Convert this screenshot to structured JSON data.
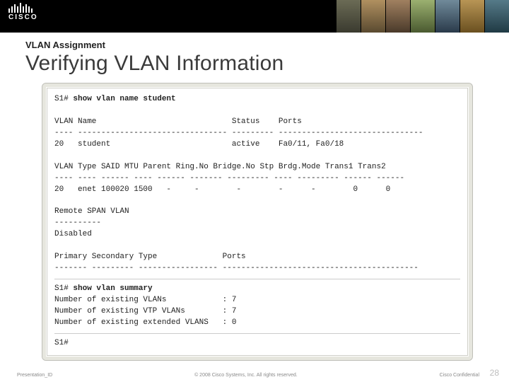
{
  "header": {
    "brand": "CISCO"
  },
  "slide": {
    "kicker": "VLAN Assignment",
    "title": "Verifying VLAN Information"
  },
  "terminal": {
    "prompt1": "S1# ",
    "cmd1": "show vlan name student",
    "head1": "VLAN Name                             Status    Ports",
    "rule1": "---- -------------------------------- --------- -------------------------------",
    "row1": "20   student                          active    Fa0/11, Fa0/18",
    "head2": "VLAN Type SAID MTU Parent Ring.No Bridge.No Stp Brdg.Mode Trans1 Trans2",
    "rule2": "---- ---- ------ ---- ------ ------- --------- ---- --------- ------ ------",
    "row2": "20   enet 100020 1500   -     -        -        -      -        0      0",
    "rspan": "Remote SPAN VLAN",
    "rspanrule": "----------",
    "disabled": "Disabled",
    "head3": "Primary Secondary Type              Ports",
    "rule3": "------- --------- ----------------- ------------------------------------------",
    "prompt2": "S1# ",
    "cmd2": "show vlan summary",
    "sum1": "Number of existing VLANs            : 7",
    "sum2": "Number of existing VTP VLANs        : 7",
    "sum3": "Number of existing extended VLANS   : 0",
    "prompt3": "S1#"
  },
  "footer": {
    "left": "Presentation_ID",
    "center": "© 2008 Cisco Systems, Inc. All rights reserved.",
    "right": "Cisco Confidential",
    "page": "28"
  }
}
